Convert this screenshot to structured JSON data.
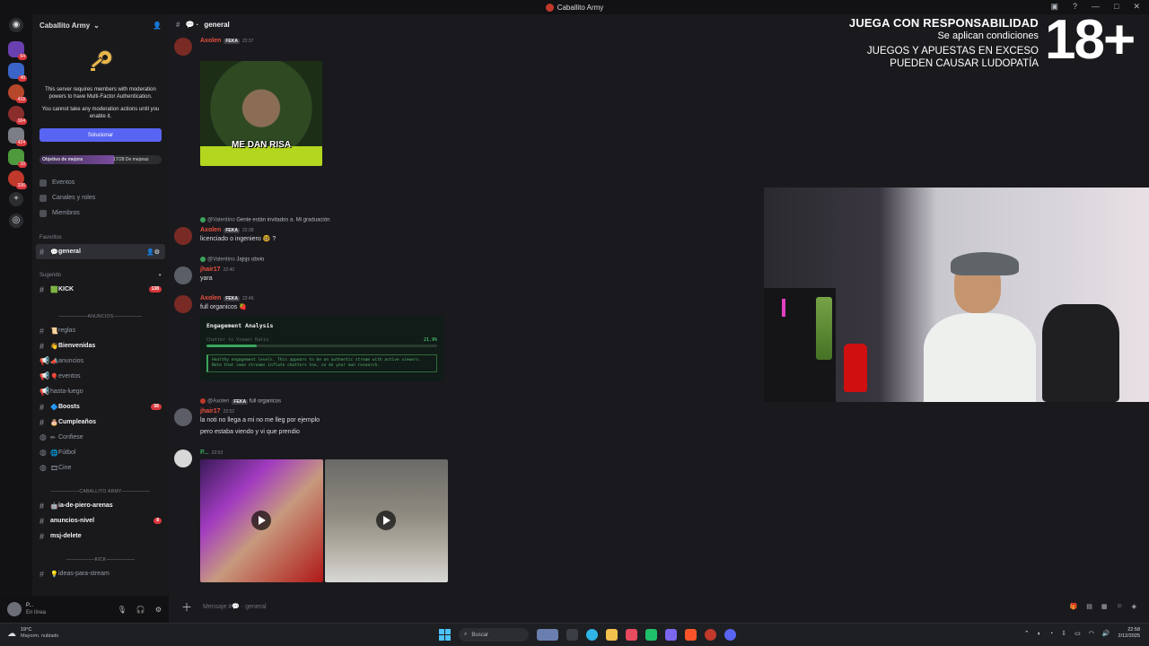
{
  "window": {
    "title": "Caballito Army"
  },
  "rail": {
    "badges": [
      "64",
      "48",
      "418",
      "164",
      "424",
      "10",
      "336"
    ]
  },
  "server": {
    "name": "Caballito Army",
    "mfa_notice": "This server requires members with moderation powers to have Multi-Factor Authentication.",
    "mfa_sub": "You cannot take any moderation actions until you enable it.",
    "fix_button": "Solucionar",
    "goal_label": "Objetivo de mejora",
    "goal_value": "17/28 De mejoras",
    "goal_progress": 0.61
  },
  "nav": [
    {
      "label": "Eventos"
    },
    {
      "label": "Canales y roles"
    },
    {
      "label": "Miembros"
    }
  ],
  "sections": {
    "favorites": "Favoritos",
    "suggested": "Sugerido",
    "anuncios": "ANUNCIOS",
    "caballito": "CABALLITO ARMY",
    "kick": "KICK"
  },
  "channels": {
    "favorite": {
      "label": "general"
    },
    "suggested": {
      "label": "KICK",
      "badge": "138"
    },
    "anuncios": [
      {
        "label": "reglas"
      },
      {
        "label": "Bienvenidas"
      },
      {
        "label": "anuncios"
      },
      {
        "label": "eventos"
      },
      {
        "label": "hasta-luego"
      },
      {
        "label": "Boosts",
        "badge": "56"
      },
      {
        "label": "Cumpleaños"
      },
      {
        "label": "Confiese"
      },
      {
        "label": "Fútbol"
      },
      {
        "label": "Cine"
      }
    ],
    "caballito": [
      {
        "label": "ia-de-piero-arenas"
      },
      {
        "label": "anuncios-nivel",
        "badge": "8"
      },
      {
        "label": "msj-delete"
      }
    ],
    "kick": [
      {
        "label": "ideas-para-stream"
      }
    ]
  },
  "user": {
    "name": "P...",
    "status": "En línea"
  },
  "chat": {
    "channel": "general",
    "composer_placeholder": "Mensaje #",
    "composer_channel": "general",
    "messages": {
      "m1": {
        "user": "Axolen",
        "tag": "FEKA",
        "time": "22:37",
        "meme_caption": "ME DAN RISA"
      },
      "r1": {
        "mention": "@Valentino",
        "text": "Gente están invitados a. Mi graduación"
      },
      "m2": {
        "user": "Axolen",
        "tag": "FEKA",
        "time": "22:38",
        "text": "licenciado o ingeniero 🤓 ?"
      },
      "r2": {
        "mention": "@Valentino",
        "text": "Jajsjs obvio"
      },
      "m3": {
        "user": "jhair17",
        "time": "22:40",
        "text": "yara"
      },
      "m4": {
        "user": "Axolen",
        "tag": "FEKA",
        "time": "22:46",
        "text": "full organicos 🍓"
      },
      "r3": {
        "mention": "@Axolen",
        "tag": "FEKA",
        "text": "full organicos"
      },
      "m5": {
        "user": "jhair17",
        "time": "22:52",
        "lines": [
          "la noti no llega a mi no me lleg por ejemplo",
          "pero estaba viendo y vi que prendio"
        ]
      },
      "m6": {
        "user": "P...",
        "time": "22:53"
      }
    },
    "embed": {
      "title": "Engagement Analysis",
      "metric": "Chatter to Viewer Ratio",
      "value": "21.9%",
      "bar": 0.219,
      "note": "Healthy engagement levels. This appears to be an authentic stream with active viewers. Note that some streams inflate chatters too, so do your own research."
    }
  },
  "overlay": {
    "heading": "JUEGA CON RESPONSABILIDAD",
    "conditions": "Se aplican condiciones",
    "warning1": "JUEGOS Y APUESTAS EN EXCESO",
    "warning2": "PUEDEN CAUSAR LUDOPATÍA",
    "age": "18+"
  },
  "taskbar": {
    "temp": "19°C",
    "weather": "Mayorm. nublado",
    "search": "Buscar",
    "time": "22:58",
    "date": "2/12/2025"
  },
  "colors": {
    "accent": "#5865f2",
    "mention_red": "#da373c",
    "username": "#e9503e"
  }
}
